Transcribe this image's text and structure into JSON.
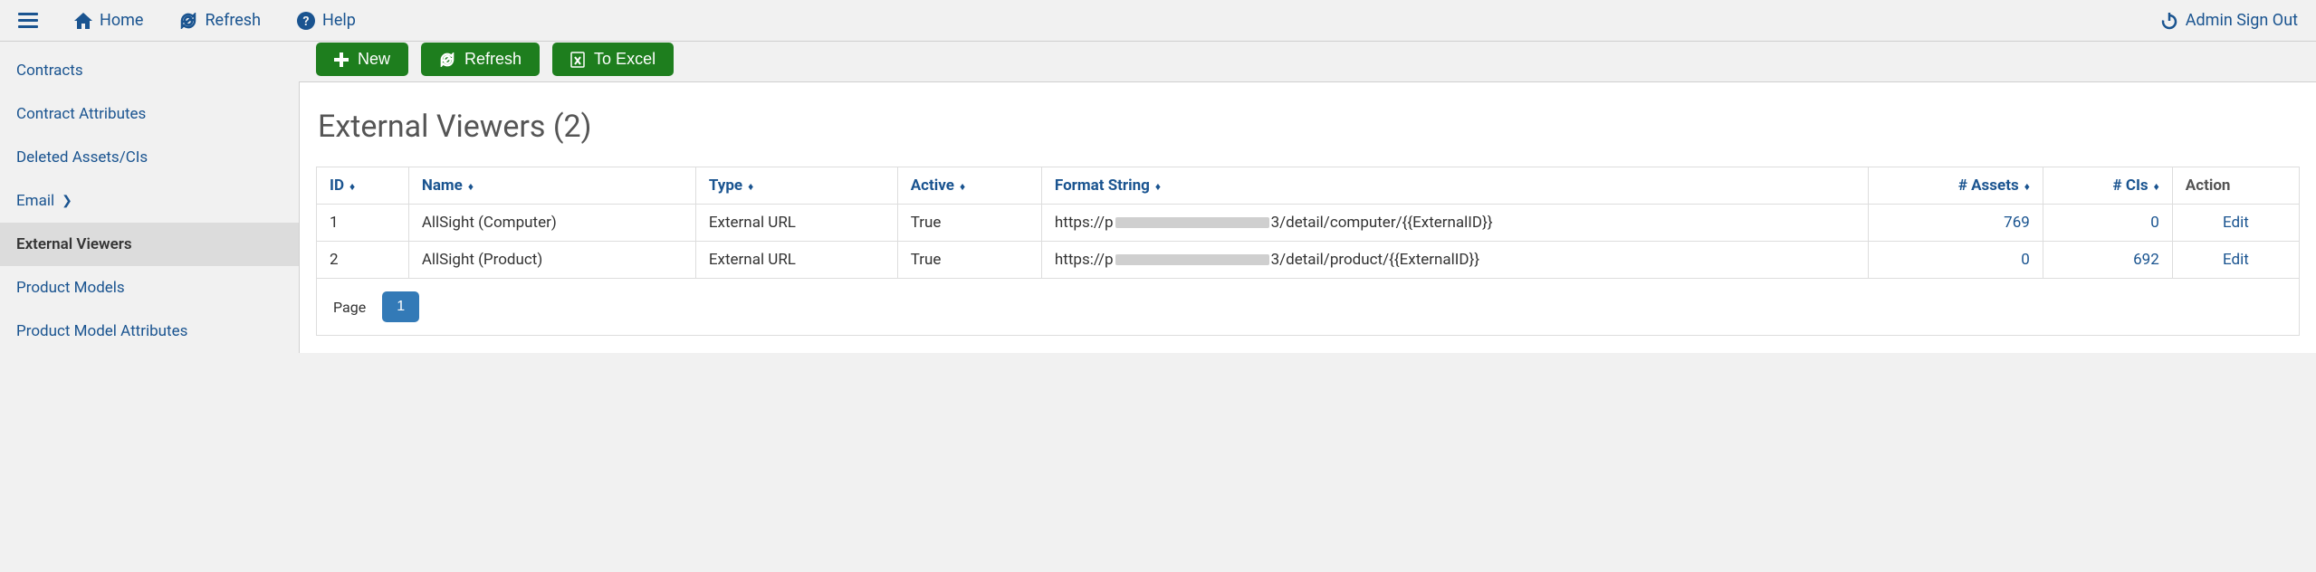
{
  "topbar": {
    "home_label": "Home",
    "refresh_label": "Refresh",
    "help_label": "Help",
    "signout_label": "Admin Sign Out"
  },
  "sidebar": {
    "items": [
      {
        "label": "Contracts",
        "active": false,
        "has_chevron": false
      },
      {
        "label": "Contract Attributes",
        "active": false,
        "has_chevron": false
      },
      {
        "label": "Deleted Assets/CIs",
        "active": false,
        "has_chevron": false
      },
      {
        "label": "Email",
        "active": false,
        "has_chevron": true
      },
      {
        "label": "External Viewers",
        "active": true,
        "has_chevron": false
      },
      {
        "label": "Product Models",
        "active": false,
        "has_chevron": false
      },
      {
        "label": "Product Model Attributes",
        "active": false,
        "has_chevron": false
      }
    ]
  },
  "actions": {
    "new_label": "New",
    "refresh_label": "Refresh",
    "excel_label": "To Excel"
  },
  "page": {
    "title": "External Viewers (2)"
  },
  "table": {
    "headers": {
      "id": "ID",
      "name": "Name",
      "type": "Type",
      "active": "Active",
      "format_string": "Format String",
      "num_assets": "# Assets",
      "num_cis": "# CIs",
      "action": "Action"
    },
    "rows": [
      {
        "id": "1",
        "name": "AllSight (Computer)",
        "type": "External URL",
        "active": "True",
        "format_prefix": "https://p",
        "format_suffix": "3/detail/computer/{{ExternalID}}",
        "num_assets": "769",
        "num_cis": "0",
        "action": "Edit"
      },
      {
        "id": "2",
        "name": "AllSight (Product)",
        "type": "External URL",
        "active": "True",
        "format_prefix": "https://p",
        "format_suffix": "3/detail/product/{{ExternalID}}",
        "num_assets": "0",
        "num_cis": "692",
        "action": "Edit"
      }
    ]
  },
  "pagination": {
    "label": "Page",
    "current": "1"
  }
}
